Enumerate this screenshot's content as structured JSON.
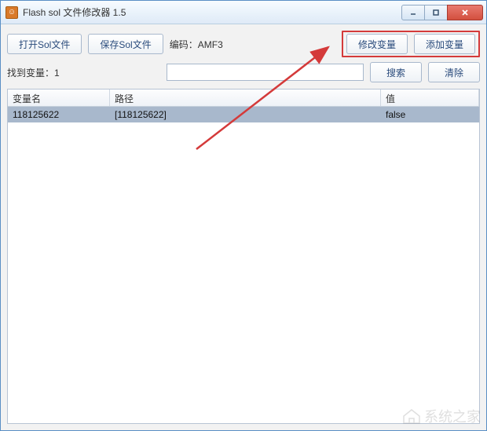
{
  "window": {
    "title": "Flash sol 文件修改器 1.5"
  },
  "toolbar": {
    "open_label": "打开Sol文件",
    "save_label": "保存Sol文件",
    "encoding_label": "编码：",
    "encoding_value": "AMF3",
    "modify_label": "修改变量",
    "add_label": "添加变量"
  },
  "search": {
    "found_label": "找到变量：",
    "found_count": "1",
    "input_value": "",
    "search_label": "搜索",
    "clear_label": "清除"
  },
  "table": {
    "headers": {
      "name": "变量名",
      "path": "路径",
      "value": "值"
    },
    "rows": [
      {
        "name": "118125622",
        "path": "[118125622]",
        "value": "false"
      }
    ]
  },
  "watermark": "系统之家"
}
